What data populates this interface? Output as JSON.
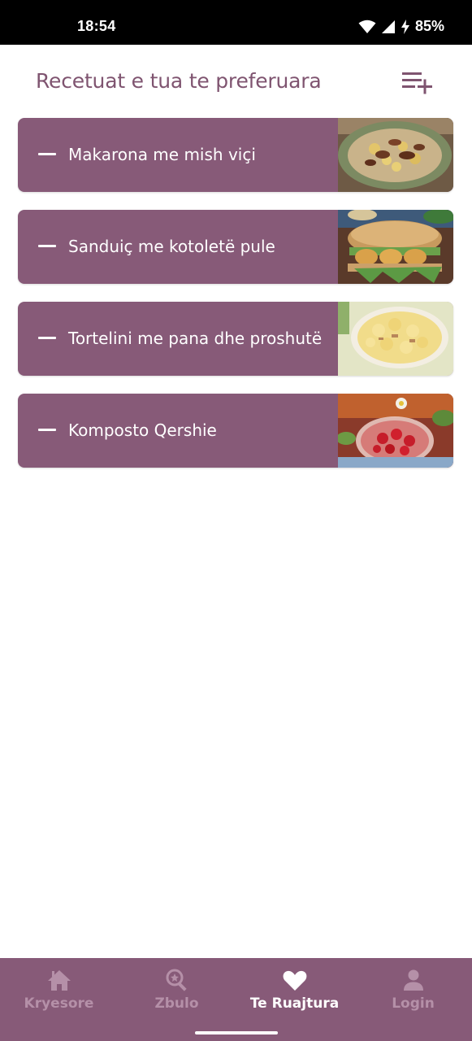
{
  "status_bar": {
    "time": "18:54",
    "battery": "85%",
    "icons": [
      "wifi-icon",
      "signal-icon",
      "charging-icon"
    ]
  },
  "header": {
    "title": "Recetuat e tua te preferuara",
    "add_icon": "playlist-add-icon"
  },
  "recipes": [
    {
      "name": "Makarona me mish viçi",
      "image": "pasta-with-beef"
    },
    {
      "name": "Sanduiç me kotoletë pule",
      "image": "chicken-cutlet-sandwich"
    },
    {
      "name": "Tortelini me pana dhe proshutë",
      "image": "tortellini-cream-ham"
    },
    {
      "name": "Komposto Qershie",
      "image": "cherry-compote"
    }
  ],
  "bottom_nav": {
    "items": [
      {
        "label": "Kryesore",
        "icon": "home-icon",
        "active": false
      },
      {
        "label": "Zbulo",
        "icon": "search-star-icon",
        "active": false
      },
      {
        "label": "Te Ruajtura",
        "icon": "heart-icon",
        "active": true
      },
      {
        "label": "Login",
        "icon": "person-icon",
        "active": false
      }
    ]
  },
  "colors": {
    "primary": "#875a78",
    "title": "#7f5470",
    "nav_inactive": "#b590a8",
    "nav_active": "#ffffff"
  }
}
